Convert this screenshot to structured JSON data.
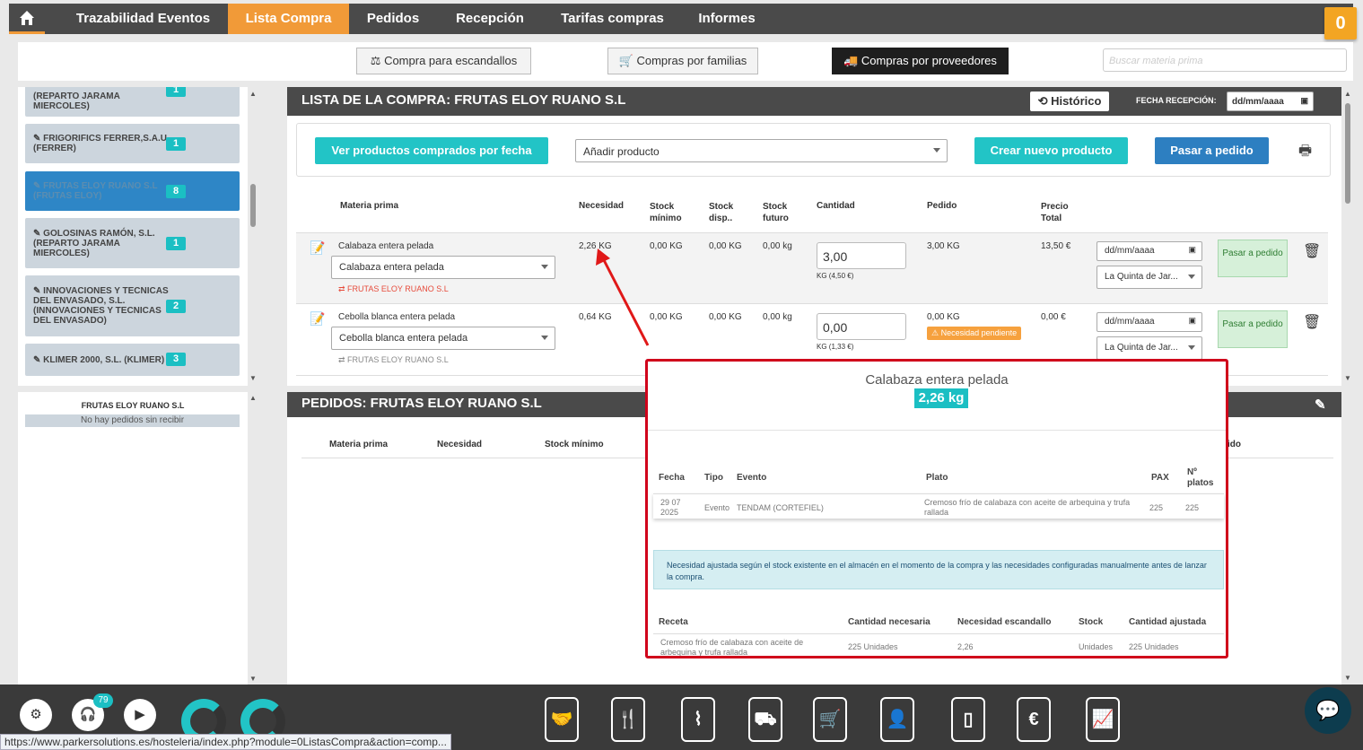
{
  "topnav": {
    "tabs": [
      {
        "label": "Trazabilidad Eventos"
      },
      {
        "label": "Lista Compra"
      },
      {
        "label": "Pedidos"
      },
      {
        "label": "Recepción"
      },
      {
        "label": "Tarifas compras"
      },
      {
        "label": "Informes"
      }
    ],
    "cart_count": "0"
  },
  "subnav": {
    "btn1": "Compra para escandallos",
    "btn2": "Compras por familias",
    "btn3": "Compras por proveedores",
    "search_placeholder": "Buscar materia prima"
  },
  "suppliers": [
    {
      "name": "(REPARTO JARAMA MIERCOLES)",
      "count": "1"
    },
    {
      "name": "FRIGORIFICS FERRER,S.A.U. (FERRER)",
      "count": "1"
    },
    {
      "name": "FRUTAS ELOY RUANO S.L (FRUTAS ELOY)",
      "count": "8"
    },
    {
      "name": "GOLOSINAS RAMÓN, S.L. (REPARTO JARAMA MIERCOLES)",
      "count": "1"
    },
    {
      "name": "INNOVACIONES Y TECNICAS DEL ENVASADO, S.L. (INNOVACIONES Y TECNICAS DEL ENVASADO)",
      "count": "2"
    },
    {
      "name": "KLIMER 2000, S.L. (KLIMER)",
      "count": "3"
    }
  ],
  "left_bottom": {
    "supplier": "FRUTAS ELOY RUANO S.L",
    "no_orders": "No hay pedidos sin recibir"
  },
  "list": {
    "title": "LISTA DE LA COMPRA: FRUTAS ELOY RUANO S.L",
    "historico": "Histórico",
    "fecha_label": "FECHA RECEPCIÓN:",
    "fecha_placeholder": "dd/mm/aaaa",
    "btn_ver": "Ver productos comprados por fecha",
    "add_product": "Añadir producto",
    "btn_crear": "Crear nuevo producto",
    "btn_pasar": "Pasar a pedido",
    "headers": {
      "materia": "Materia prima",
      "necesidad": "Necesidad",
      "stock_min": "Stock mínimo",
      "stock_disp": "Stock disp..",
      "stock_fut": "Stock futuro",
      "cantidad": "Cantidad",
      "pedido": "Pedido",
      "precio": "Precio Total"
    },
    "rows": [
      {
        "name": "Calabaza entera pelada",
        "select": "Calabaza entera pelada",
        "supplier": "FRUTAS ELOY RUANO S.L",
        "necesidad": "2,26 KG",
        "stock_min": "0,00 KG",
        "stock_disp": "0,00 KG",
        "stock_fut": "0,00 kg",
        "cantidad": "3,00",
        "cantidad_sub": "KG (4,50 €)",
        "pedido": "3,00 KG",
        "precio": "13,50 €",
        "date": "dd/mm/aaaa",
        "location": "La Quinta de Jar...",
        "action": "Pasar a pedido"
      },
      {
        "name": "Cebolla blanca entera pelada",
        "select": "Cebolla blanca entera pelada",
        "supplier": "FRUTAS ELOY RUANO S.L",
        "necesidad": "0,64 KG",
        "stock_min": "0,00 KG",
        "stock_disp": "0,00 KG",
        "stock_fut": "0,00 kg",
        "cantidad": "0,00",
        "cantidad_sub": "KG (1,33 €)",
        "pedido": "0,00 KG",
        "warning": "Necesidad pendiente",
        "precio": "0,00 €",
        "date": "dd/mm/aaaa",
        "location": "La Quinta de Jar...",
        "action": "Pasar a pedido"
      }
    ]
  },
  "orders": {
    "title": "PEDIDOS: FRUTAS ELOY RUANO S.L",
    "headers": {
      "materia": "Materia prima",
      "necesidad": "Necesidad",
      "stock_min": "Stock mínimo",
      "pedido_trunc": "ido"
    }
  },
  "popup": {
    "title": "Calabaza entera pelada",
    "badge": "2,26 kg",
    "headers": {
      "fecha": "Fecha",
      "tipo": "Tipo",
      "evento": "Evento",
      "plato": "Plato",
      "pax": "PAX",
      "nplatos": "Nº platos"
    },
    "row": {
      "fecha": "29 07 2025",
      "tipo": "Evento",
      "evento": "TENDAM (CORTEFIEL)",
      "plato": "Cremoso frío de calabaza con aceite de arbequina y trufa rallada",
      "pax": "225",
      "nplatos": "225"
    },
    "info": "Necesidad ajustada según el stock existente en el almacén en el momento de la compra y las necesidades configuradas manualmente antes de lanzar la compra.",
    "headers2": {
      "receta": "Receta",
      "cant_nec": "Cantidad necesaria",
      "nec_esc": "Necesidad escandallo",
      "stock": "Stock",
      "cant_aj": "Cantidad ajustada"
    },
    "row2": {
      "receta": "Cremoso frío de calabaza con aceite de arbequina y trufa rallada",
      "cant_nec": "225 Unidades",
      "nec_esc": "2,26",
      "stock": "Unidades",
      "cant_aj": "225 Unidades"
    }
  },
  "bottombar": {
    "headset_badge": "79"
  },
  "statusbar": "https://www.parkersolutions.es/hosteleria/index.php?module=0ListasCompra&action=comp..."
}
